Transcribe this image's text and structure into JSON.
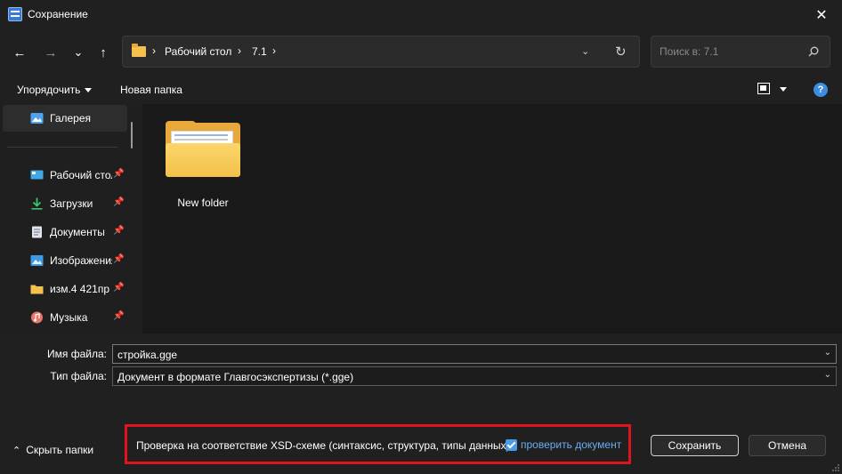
{
  "window": {
    "title": "Сохранение",
    "close_glyph": "✕"
  },
  "nav": {
    "back_glyph": "←",
    "forward_glyph": "→",
    "recent_glyph": "⌄",
    "up_glyph": "↑",
    "breadcrumb": [
      "Рабочий стол",
      "7.1"
    ],
    "separator": "›",
    "dropdown_glyph": "⌄",
    "refresh_glyph": "↻",
    "search_placeholder": "Поиск в: 7.1"
  },
  "toolbar": {
    "organize": "Упорядочить",
    "new_folder": "Новая папка",
    "help": "?"
  },
  "sidebar": {
    "pin_glyph": "📌",
    "items": [
      {
        "label": "Галерея",
        "icon": "gallery-icon"
      },
      {
        "label": "Рабочий стол",
        "icon": "desktop-icon"
      },
      {
        "label": "Загрузки",
        "icon": "downloads-icon"
      },
      {
        "label": "Документы",
        "icon": "documents-icon"
      },
      {
        "label": "Изображения",
        "icon": "pictures-icon"
      },
      {
        "label": "изм.4 421пр",
        "icon": "folder-icon"
      },
      {
        "label": "Музыка",
        "icon": "music-icon"
      }
    ]
  },
  "content": {
    "items": [
      {
        "name": "New folder",
        "type": "folder"
      }
    ]
  },
  "form": {
    "filename_label": "Имя файла:",
    "filename_value": "стройка.gge",
    "filetype_label": "Тип файла:",
    "filetype_value": "Документ в формате Главгосэкспертизы (*.gge)",
    "dropdown_glyph": "⌄"
  },
  "footer": {
    "hide_folders": "Скрыть папки",
    "hide_glyph": "⌃",
    "validation_text": "Проверка на соответствие XSD-схеме (синтаксис, структура, типы данных)",
    "validation_checkbox_label": "проверить документ",
    "validation_checked": true,
    "save_label": "Сохранить",
    "cancel_label": "Отмена"
  },
  "colors": {
    "background": "#202020",
    "content_bg": "#191919",
    "accent": "#4a9be8",
    "highlight_border": "#e0141e",
    "folder_yellow": "#f3c04b"
  }
}
